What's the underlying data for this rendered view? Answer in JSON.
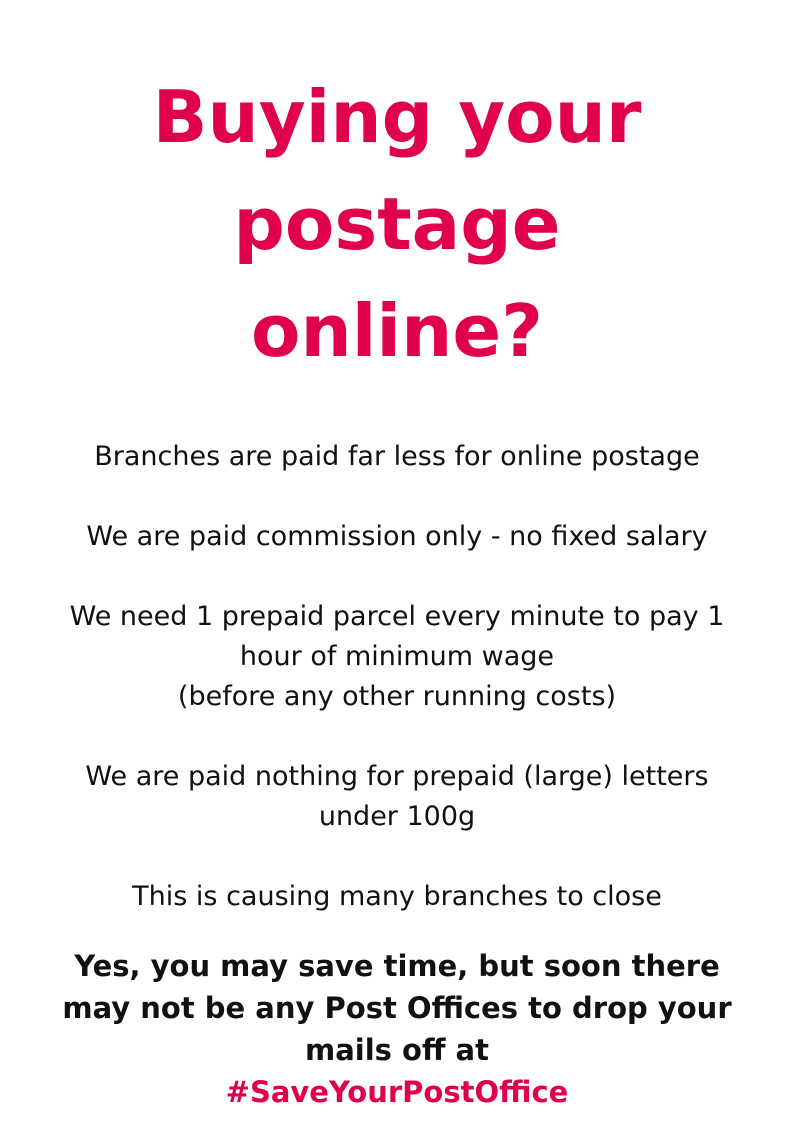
{
  "title": {
    "lines": [
      "Buying your",
      "postage",
      "online?"
    ]
  },
  "points": [
    {
      "lines": [
        "Branches are paid far less for online postage"
      ]
    },
    {
      "lines": [
        "We are paid commission only - no fixed salary"
      ]
    },
    {
      "lines": [
        "We need 1 prepaid parcel every minute to pay 1",
        "hour of minimum wage",
        "(before any other running costs)"
      ]
    },
    {
      "lines": [
        "We are paid nothing for prepaid (large) letters",
        "under 100g"
      ]
    },
    {
      "lines": [
        "This is causing many branches to close"
      ]
    }
  ],
  "callout": {
    "lines": [
      "Yes, you may save time, but soon there",
      "may not be any Post Offices to drop your",
      "mails off at"
    ],
    "hashtag": "#SaveYourPostOffice"
  },
  "colors": {
    "accent": "#e0004d",
    "text": "#111111",
    "background": "#ffffff"
  }
}
